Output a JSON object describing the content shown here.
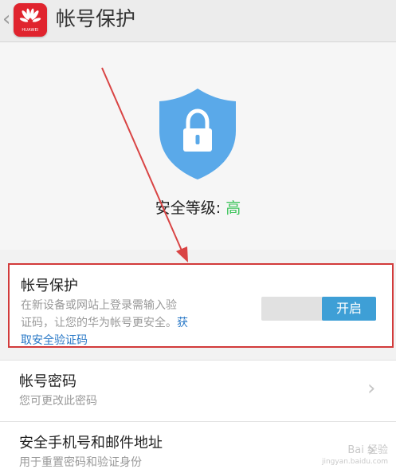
{
  "header": {
    "back_icon": "chevron-left-icon",
    "logo_text": "HUAWEI",
    "title": "帐号保护"
  },
  "security": {
    "icon": "shield-lock-icon",
    "level_label": "安全等级: ",
    "level_value": "高",
    "level_color": "#3cc45a",
    "shield_color": "#5aa9e9"
  },
  "protection": {
    "title": "帐号保护",
    "desc_line1": "在新设备或网站上登录需输入验",
    "desc_line2": "证码，让您的华为帐号更安全。",
    "link_part1": "获",
    "link_part2": "取安全验证码",
    "toggle_label": "开启",
    "toggle_on": true
  },
  "rows": [
    {
      "title": "帐号密码",
      "desc": "您可更改此密码"
    },
    {
      "title": "安全手机号和邮件地址",
      "desc": "用于重置密码和验证身份"
    }
  ],
  "watermark": {
    "text": "Bai 经验",
    "sub": "jingyan.baidu.com"
  }
}
